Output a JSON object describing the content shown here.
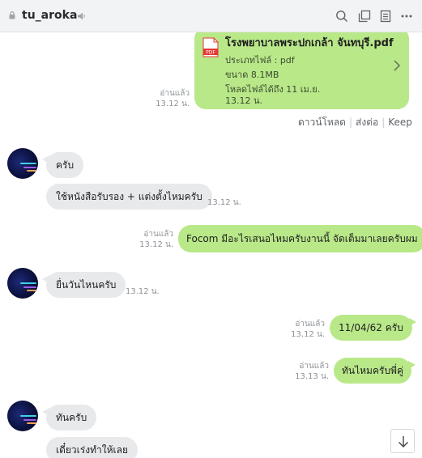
{
  "header": {
    "title": "tu_aroka"
  },
  "file_message": {
    "name": "โรงพยาบาลพระปกเกล้า จันทบุรี.pdf",
    "type_line": "ประเภทไฟล์ : pdf",
    "size_line": "ขนาด 8.1MB",
    "expiry_line1": "โหลดไฟล์ได้ถึง 11 เม.ย.",
    "expiry_line2": "13.12 น.",
    "read_label": "อ่านแล้ว",
    "time": "13.12 น.",
    "actions": {
      "download": "ดาวน์โหลด",
      "share": "ส่งต่อ",
      "keep": "Keep"
    }
  },
  "messages": [
    {
      "text": "ครับ",
      "time": ""
    },
    {
      "text": "ใช้หนังสือรับรอง + แต่งตั้งไหมครับ",
      "time": "13.12 น."
    },
    {
      "text": "Focom มีอะไรเสนอไหมครับงานนี้ จัดเต็มมาเลยครับผม",
      "read": "อ่านแล้ว",
      "time": "13.12 น."
    },
    {
      "text": "ยื่นวันไหนครับ",
      "time": "13.12 น."
    },
    {
      "text": "11/04/62 ครับ",
      "read": "อ่านแล้ว",
      "time": "13.12 น."
    },
    {
      "text": "ทันไหมครับพี่คู่",
      "read": "อ่านแล้ว",
      "time": "13.13 น."
    },
    {
      "text": "ทันครับ",
      "time": ""
    },
    {
      "text": "เดี๋ยวเร่งทำให้เลย",
      "time": ""
    }
  ],
  "colors": {
    "incoming": "#e8e9eb",
    "outgoing": "#b9e889",
    "header": "#f2f3f5"
  }
}
